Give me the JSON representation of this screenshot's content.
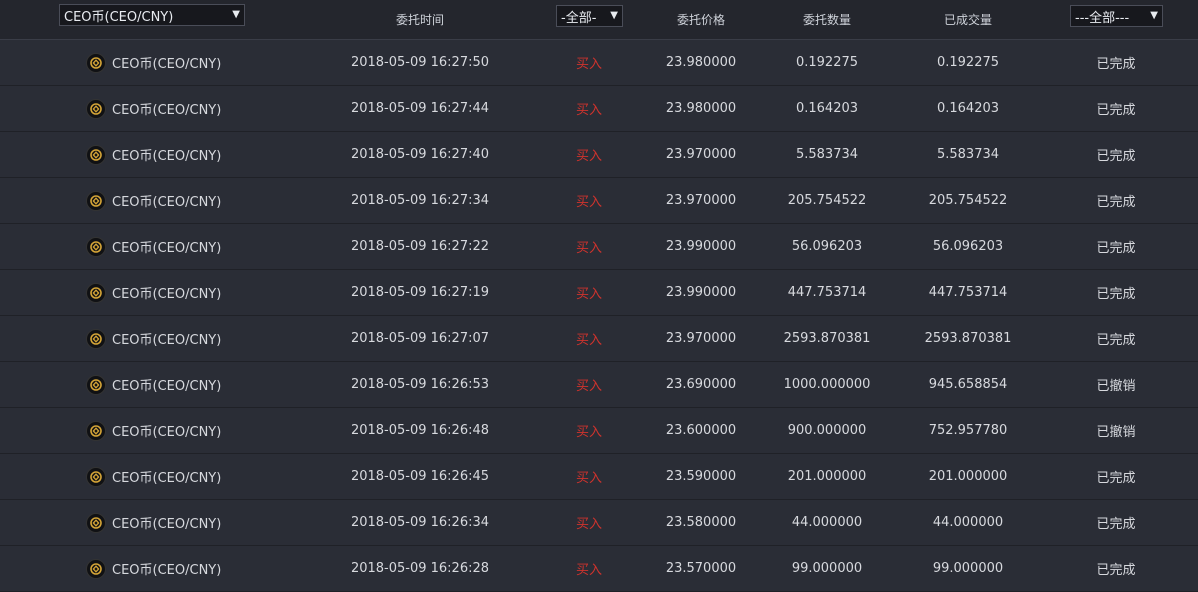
{
  "header": {
    "pair_select": "CEO币(CEO/CNY)",
    "time_label": "委托时间",
    "side_select": "-全部-",
    "price_label": "委托价格",
    "amount_label": "委托数量",
    "filled_label": "已成交量",
    "status_select": "---全部---",
    "arrow": "▼"
  },
  "colors": {
    "buy": "#d0332d",
    "icon_gold": "#d4a437"
  },
  "rows": [
    {
      "pair": "CEO币(CEO/CNY)",
      "time": "2018-05-09 16:27:50",
      "side": "买入",
      "price": "23.980000",
      "amount": "0.192275",
      "filled": "0.192275",
      "status": "已完成"
    },
    {
      "pair": "CEO币(CEO/CNY)",
      "time": "2018-05-09 16:27:44",
      "side": "买入",
      "price": "23.980000",
      "amount": "0.164203",
      "filled": "0.164203",
      "status": "已完成"
    },
    {
      "pair": "CEO币(CEO/CNY)",
      "time": "2018-05-09 16:27:40",
      "side": "买入",
      "price": "23.970000",
      "amount": "5.583734",
      "filled": "5.583734",
      "status": "已完成"
    },
    {
      "pair": "CEO币(CEO/CNY)",
      "time": "2018-05-09 16:27:34",
      "side": "买入",
      "price": "23.970000",
      "amount": "205.754522",
      "filled": "205.754522",
      "status": "已完成"
    },
    {
      "pair": "CEO币(CEO/CNY)",
      "time": "2018-05-09 16:27:22",
      "side": "买入",
      "price": "23.990000",
      "amount": "56.096203",
      "filled": "56.096203",
      "status": "已完成"
    },
    {
      "pair": "CEO币(CEO/CNY)",
      "time": "2018-05-09 16:27:19",
      "side": "买入",
      "price": "23.990000",
      "amount": "447.753714",
      "filled": "447.753714",
      "status": "已完成"
    },
    {
      "pair": "CEO币(CEO/CNY)",
      "time": "2018-05-09 16:27:07",
      "side": "买入",
      "price": "23.970000",
      "amount": "2593.870381",
      "filled": "2593.870381",
      "status": "已完成"
    },
    {
      "pair": "CEO币(CEO/CNY)",
      "time": "2018-05-09 16:26:53",
      "side": "买入",
      "price": "23.690000",
      "amount": "1000.000000",
      "filled": "945.658854",
      "status": "已撤销"
    },
    {
      "pair": "CEO币(CEO/CNY)",
      "time": "2018-05-09 16:26:48",
      "side": "买入",
      "price": "23.600000",
      "amount": "900.000000",
      "filled": "752.957780",
      "status": "已撤销"
    },
    {
      "pair": "CEO币(CEO/CNY)",
      "time": "2018-05-09 16:26:45",
      "side": "买入",
      "price": "23.590000",
      "amount": "201.000000",
      "filled": "201.000000",
      "status": "已完成"
    },
    {
      "pair": "CEO币(CEO/CNY)",
      "time": "2018-05-09 16:26:34",
      "side": "买入",
      "price": "23.580000",
      "amount": "44.000000",
      "filled": "44.000000",
      "status": "已完成"
    },
    {
      "pair": "CEO币(CEO/CNY)",
      "time": "2018-05-09 16:26:28",
      "side": "买入",
      "price": "23.570000",
      "amount": "99.000000",
      "filled": "99.000000",
      "status": "已完成"
    }
  ]
}
